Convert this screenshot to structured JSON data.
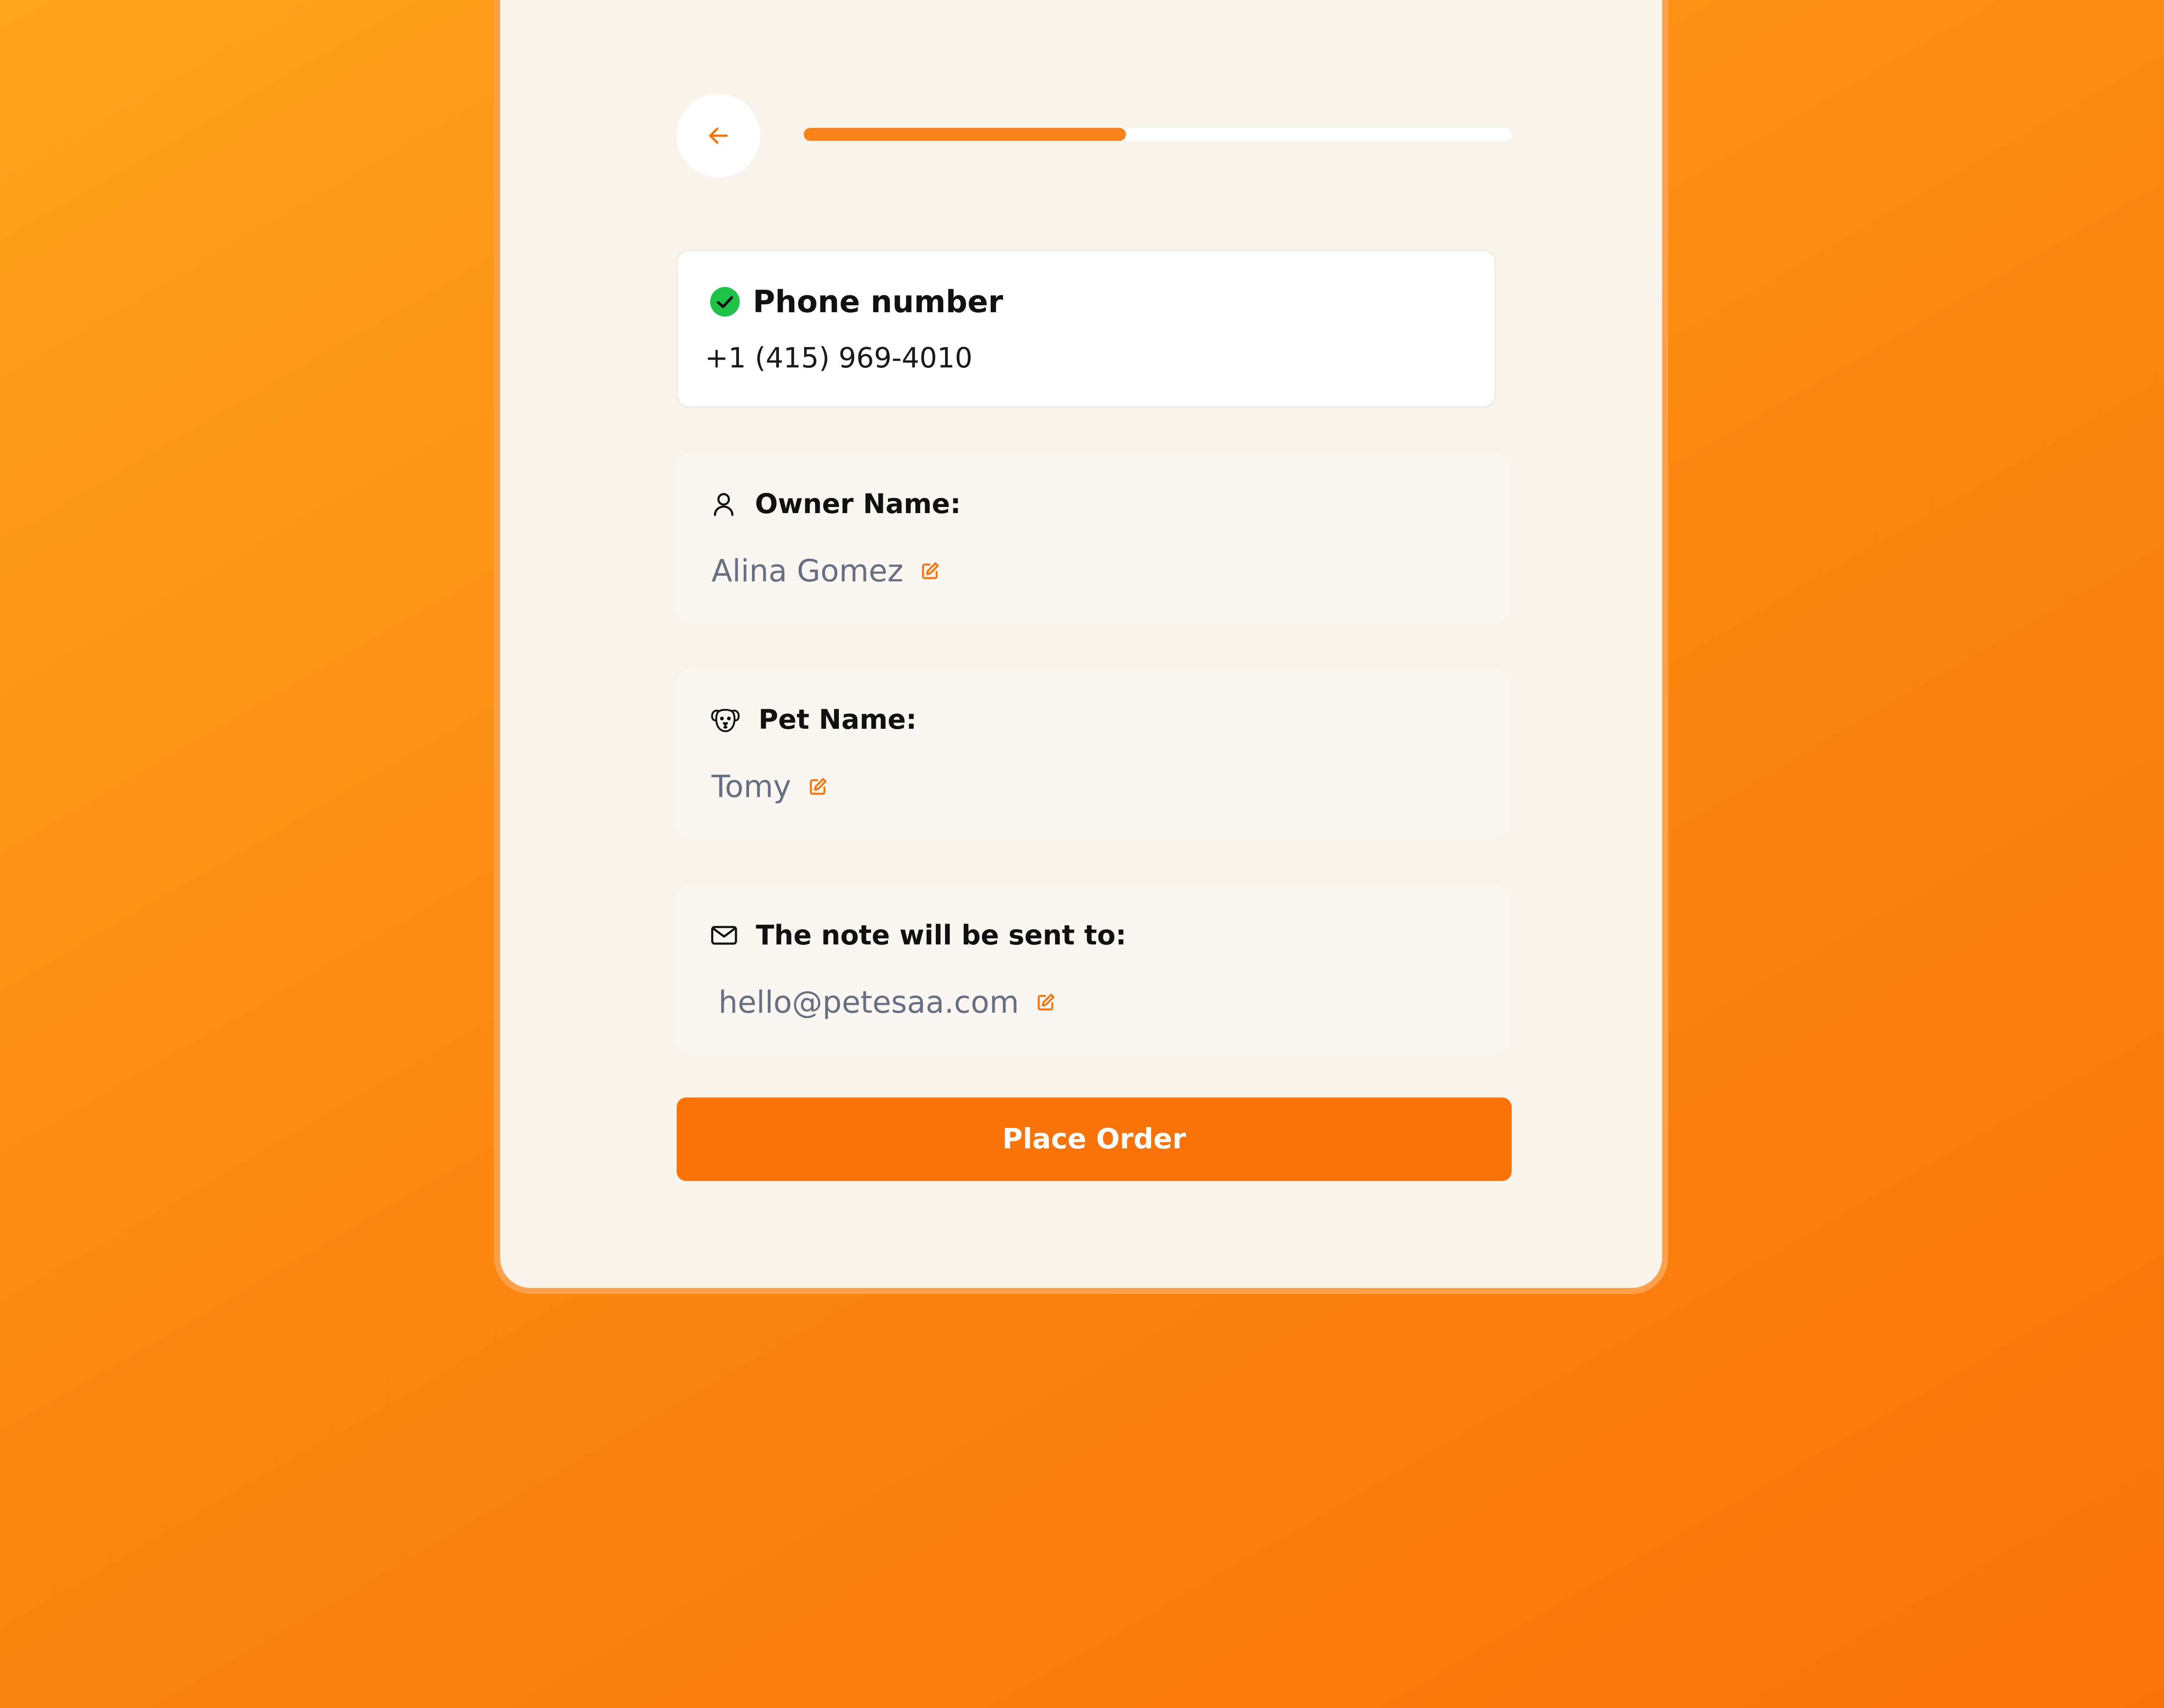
{
  "colors": {
    "accent": "#F97309",
    "progress_fill": "#F7831A",
    "success": "#1DC247",
    "card_background": "#F8F4EC",
    "field_value_text": "#667080"
  },
  "progress": {
    "fraction": 0.455
  },
  "back_button": {
    "icon": "arrow-left-icon"
  },
  "phone": {
    "icon": "check-circle-icon",
    "title": "Phone number",
    "value": "+1 (415) 969-4010"
  },
  "fields": [
    {
      "icon": "user-icon",
      "label": "Owner Name:",
      "value": "Alina Gomez",
      "edit_icon": "edit-icon"
    },
    {
      "icon": "dog-icon",
      "label": "Pet Name:",
      "value": "Tomy",
      "edit_icon": "edit-icon"
    },
    {
      "icon": "mail-icon",
      "label": "The note will be sent to:",
      "value": "hello@petesaa.com",
      "edit_icon": "edit-icon"
    }
  ],
  "place_order": {
    "label": "Place Order"
  }
}
